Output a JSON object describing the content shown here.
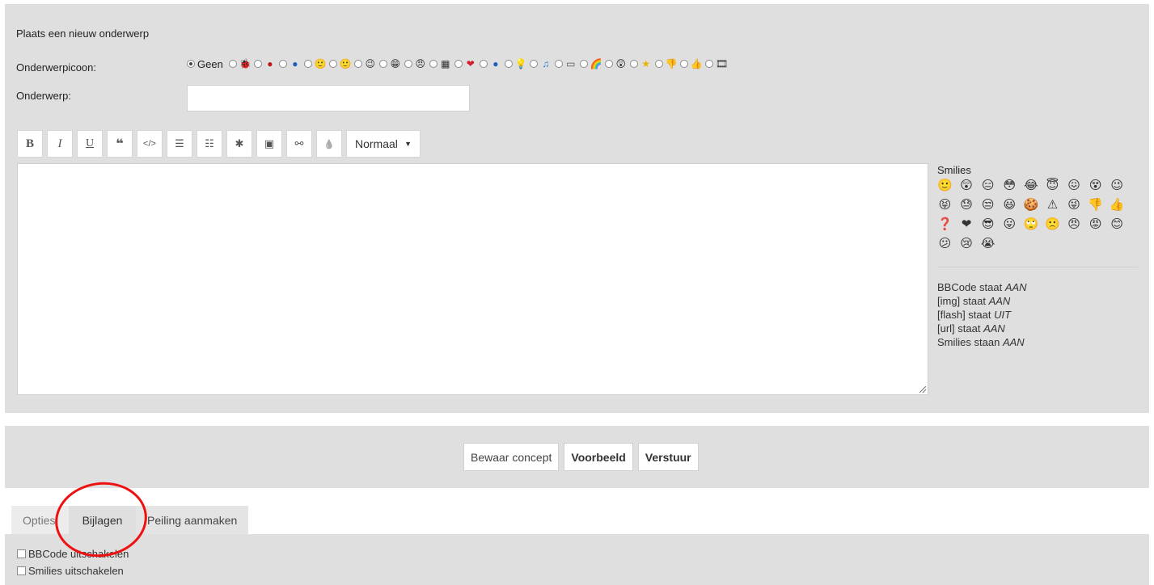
{
  "form": {
    "heading": "Plaats een nieuw onderwerp",
    "icon_label": "Onderwerpicoon:",
    "none_label": "Geen",
    "subject_label": "Onderwerp:",
    "subject_value": ""
  },
  "topic_icons": [
    {
      "name": "bug-icon",
      "glyph": "🐞",
      "color": "#4a7a1a"
    },
    {
      "name": "exclamation-icon",
      "glyph": "●",
      "color": "#c01818"
    },
    {
      "name": "question-icon",
      "glyph": "●",
      "color": "#1d5fbf"
    },
    {
      "name": "smiley-icon",
      "glyph": "🙂"
    },
    {
      "name": "smile-icon",
      "glyph": "🙂"
    },
    {
      "name": "wink-icon",
      "glyph": "😉"
    },
    {
      "name": "grin-icon",
      "glyph": "😁"
    },
    {
      "name": "angry-icon",
      "glyph": "😠"
    },
    {
      "name": "film-strip-icon",
      "glyph": "▦",
      "color": "#333333"
    },
    {
      "name": "heart-icon",
      "glyph": "❤",
      "color": "#d02030"
    },
    {
      "name": "info-icon",
      "glyph": "●",
      "color": "#1d5fbf"
    },
    {
      "name": "lightbulb-icon",
      "glyph": "💡"
    },
    {
      "name": "music-note-icon",
      "glyph": "♫",
      "color": "#2a7fd0"
    },
    {
      "name": "screen-icon",
      "glyph": "▭",
      "color": "#555555"
    },
    {
      "name": "rainbow-icon",
      "glyph": "🌈"
    },
    {
      "name": "shocked-icon",
      "glyph": "😲"
    },
    {
      "name": "star-icon",
      "glyph": "★",
      "color": "#e8b400"
    },
    {
      "name": "thumbs-down-icon",
      "glyph": "👎"
    },
    {
      "name": "thumbs-up-icon",
      "glyph": "👍"
    },
    {
      "name": "film-icon",
      "glyph": "🎞"
    }
  ],
  "toolbar": {
    "bold": "B",
    "italic": "I",
    "underline": "U",
    "quote": "❝",
    "code": "</>",
    "list": "☰",
    "numbered_list": "☷",
    "list_item": "✱",
    "image": "▣",
    "link": "⚯",
    "color": "💧",
    "font_size": "Normaal",
    "font_size_arrow": "▼"
  },
  "smilies": {
    "title": "Smilies",
    "items": [
      {
        "name": "smile-icon",
        "glyph": "🙂"
      },
      {
        "name": "surprised-icon",
        "glyph": "😲"
      },
      {
        "name": "neutral-icon",
        "glyph": "😑"
      },
      {
        "name": "flushed-icon",
        "glyph": "😳"
      },
      {
        "name": "laughing-icon",
        "glyph": "😂"
      },
      {
        "name": "angel-icon",
        "glyph": "😇"
      },
      {
        "name": "confounded-icon",
        "glyph": "😖"
      },
      {
        "name": "dizzy-icon",
        "glyph": "😵"
      },
      {
        "name": "wink-icon",
        "glyph": "😉"
      },
      {
        "name": "tongue-icon",
        "glyph": "😝"
      },
      {
        "name": "sweat-icon",
        "glyph": "😓"
      },
      {
        "name": "unamused-icon",
        "glyph": "😒"
      },
      {
        "name": "grin-icon",
        "glyph": "😃"
      },
      {
        "name": "cookie-icon",
        "glyph": "🍪"
      },
      {
        "name": "warning-icon",
        "glyph": "⚠"
      },
      {
        "name": "troll-icon",
        "glyph": "😜"
      },
      {
        "name": "thumbs-down-icon",
        "glyph": "👎"
      },
      {
        "name": "thumbs-up-icon",
        "glyph": "👍"
      },
      {
        "name": "question-icon",
        "glyph": "❓"
      },
      {
        "name": "heart-icon",
        "glyph": "❤"
      },
      {
        "name": "cool-icon",
        "glyph": "😎"
      },
      {
        "name": "tongue-out-icon",
        "glyph": "😛"
      },
      {
        "name": "rolling-eyes-icon",
        "glyph": "🙄"
      },
      {
        "name": "sad-icon",
        "glyph": "🙁"
      },
      {
        "name": "angry-icon",
        "glyph": "😠"
      },
      {
        "name": "mad-icon",
        "glyph": "😡"
      },
      {
        "name": "blush-icon",
        "glyph": "😊"
      },
      {
        "name": "confused-icon",
        "glyph": "😕"
      },
      {
        "name": "crying-icon",
        "glyph": "😢"
      },
      {
        "name": "sobbing-icon",
        "glyph": "😭"
      }
    ]
  },
  "bbcode_info": [
    {
      "label": "BBCode staat",
      "value": "AAN"
    },
    {
      "label": "[img] staat",
      "value": "AAN"
    },
    {
      "label": "[flash] staat",
      "value": "UIT"
    },
    {
      "label": "[url] staat",
      "value": "AAN"
    },
    {
      "label": "Smilies staan",
      "value": "AAN"
    }
  ],
  "actions": {
    "save_draft": "Bewaar concept",
    "preview": "Voorbeeld",
    "submit": "Verstuur"
  },
  "tabs": [
    {
      "label": "Opties"
    },
    {
      "label": "Bijlagen"
    },
    {
      "label": "Peiling aanmaken"
    }
  ],
  "options": [
    {
      "label": "BBCode uitschakelen"
    },
    {
      "label": "Smilies uitschakelen"
    }
  ],
  "colors": {
    "panel_bg": "#dfdfdf",
    "annotation": "#ee1111"
  }
}
